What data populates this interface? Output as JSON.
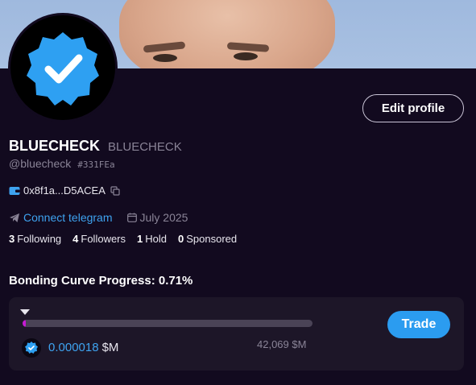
{
  "profile": {
    "name": "BLUECHECK",
    "ticker": "BLUECHECK",
    "handle": "@bluecheck",
    "id_tag": "#331FEa",
    "wallet": "0x8f1a...D5ACEA",
    "telegram_label": "Connect telegram",
    "joined": "July 2025",
    "edit_label": "Edit profile"
  },
  "stats": [
    {
      "count": "3",
      "label": "Following"
    },
    {
      "count": "4",
      "label": "Followers"
    },
    {
      "count": "1",
      "label": "Hold"
    },
    {
      "count": "0",
      "label": "Sponsored"
    }
  ],
  "bonding": {
    "label": "Bonding Curve Progress: 0.71%",
    "progress_percent": 0.71,
    "price": "0.000018",
    "price_unit": "$M",
    "market_cap": "42,069 $M",
    "trade_label": "Trade"
  },
  "colors": {
    "background": "#120a1f",
    "accent_blue": "#3ea3f0",
    "progress_fill": "#c51bd3",
    "badge_blue": "#2b9cf0"
  },
  "icons": {
    "avatar": "verified-badge-icon",
    "wallet": "wallet-icon",
    "copy": "copy-icon",
    "telegram": "telegram-icon",
    "calendar": "calendar-icon",
    "coin": "coin-badge-icon"
  }
}
